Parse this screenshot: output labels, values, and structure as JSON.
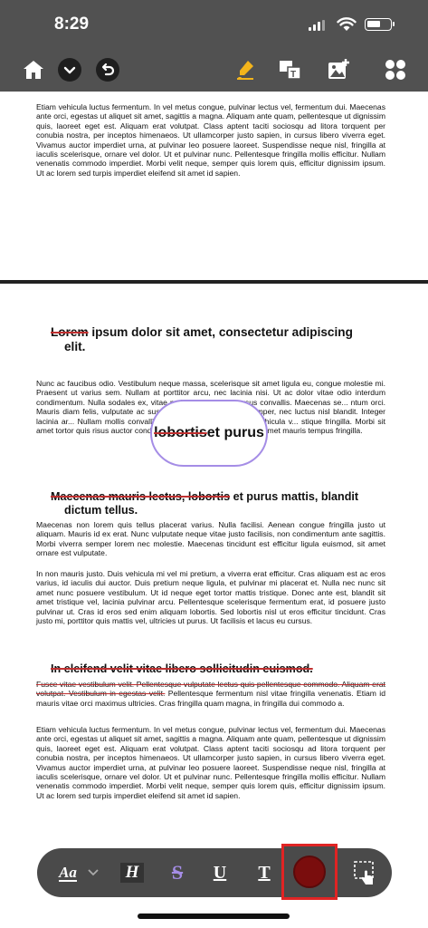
{
  "status_bar": {
    "time": "8:29"
  },
  "toolbar_top": {
    "icons": [
      "home-icon",
      "chevron-down-icon",
      "undo-icon",
      "highlighter-icon",
      "text-image-icon",
      "add-image-icon",
      "grid-menu-icon"
    ]
  },
  "document": {
    "page1_paragraph": "Etiam vehicula luctus fermentum. In vel metus congue, pulvinar lectus vel, fermentum dui. Maecenas ante orci, egestas ut aliquet sit amet, sagittis a magna. Aliquam ante quam, pellentesque ut dignissim quis, laoreet eget est. Aliquam erat volutpat. Class aptent taciti sociosqu ad litora torquent per conubia nostra, per inceptos himenaeos. Ut ullamcorper justo sapien, in cursus libero viverra eget. Vivamus auctor imperdiet urna, at pulvinar leo posuere laoreet. Suspendisse neque nisl, fringilla at iaculis scelerisque, ornare vel dolor. Ut et pulvinar nunc. Pellentesque fringilla mollis efficitur. Nullam venenatis commodo imperdiet. Morbi velit neque, semper quis lorem quis, efficitur dignissim ipsum. Ut ac lorem sed turpis imperdiet eleifend sit amet id sapien.",
    "heading1": {
      "struck": "Lorem",
      "rest_line1": " ipsum dolor sit amet, consectetur adipiscing",
      "rest_line2": "elit."
    },
    "para_a": "Nunc ac faucibus odio. Vestibulum neque massa, scelerisque sit amet ligula eu, congue molestie mi. Praesent ut varius sem. Nullam at porttitor arcu, nec lacinia nisi. Ut ac dolor vitae odio interdum condimentum. Nulla sodales ex, vitae malesuada ipsum cursus convallis. Maecenas se... ntum orci. Mauris diam felis, vulputate ac suscipit et, iaculi... ac ligula semper, nec luctus nisl blandit. Integer lacinia ar... Nullam mollis convallis ipsum, ac accumsan nunc vehicula v... stique fringilla. Morbi sit amet tortor quis risus auctor condime... ulla. Nulla iaculis tellus sit amet mauris tempus fringilla.",
    "magnifier": {
      "struck": "lobortis",
      "rest": " et purus"
    },
    "heading2": {
      "struck": "Maecenas mauris lectus, lobortis",
      "rest_line1": " et purus mattis, blandit",
      "rest_line2": "dictum tellus."
    },
    "para_b": "Maecenas non lorem quis tellus placerat varius. Nulla facilisi. Aenean congue fringilla justo ut aliquam. Mauris id ex erat. Nunc vulputate neque vitae justo facilisis, non condimentum ante sagittis. Morbi viverra semper lorem nec molestie. Maecenas tincidunt est efficitur ligula euismod, sit amet ornare est vulputate.",
    "para_c": "In non mauris justo. Duis vehicula mi vel mi pretium, a viverra erat efficitur. Cras aliquam est ac eros varius, id iaculis dui auctor. Duis pretium neque ligula, et pulvinar mi placerat et. Nulla nec nunc sit amet nunc posuere vestibulum. Ut id neque eget tortor mattis tristique. Donec ante est, blandit sit amet tristique vel, lacinia pulvinar arcu. Pellentesque scelerisque fermentum erat, id posuere justo pulvinar ut. Cras id eros sed enim aliquam lobortis. Sed lobortis nisl ut eros efficitur tincidunt. Cras justo mi, porttitor quis mattis vel, ultricies ut purus. Ut facilisis et lacus eu cursus.",
    "heading3": "In eleifend velit vitae libero sollicitudin euismod.",
    "para_d_struck": "Fusce vitae vestibulum velit. Pellentesque vulputate lectus quis pellentesque commodo. Aliquam erat volutpat. Vestibulum in egestas velit.",
    "para_d_rest": " Pellentesque fermentum nisl vitae fringilla venenatis. Etiam id mauris vitae orci maximus ultricies. Cras fringilla quam magna, in fringilla dui commodo a.",
    "para_e": "Etiam vehicula luctus fermentum. In vel metus congue, pulvinar lectus vel, fermentum dui. Maecenas ante orci, egestas ut aliquet sit amet, sagittis a magna. Aliquam ante quam, pellentesque ut dignissim quis, laoreet eget est. Aliquam erat volutpat. Class aptent taciti sociosqu ad litora torquent per conubia nostra, per inceptos himenaeos. Ut ullamcorper justo sapien, in cursus libero viverra eget. Vivamus auctor imperdiet urna, at pulvinar leo posuere laoreet. Suspendisse neque nisl, fringilla at iaculis scelerisque, ornare vel dolor. Ut et pulvinar nunc. Pellentesque fringilla mollis efficitur. Nullam venenatis commodo imperdiet. Morbi velit neque, semper quis lorem quis, efficitur dignissim ipsum. Ut ac lorem sed turpis imperdiet eleifend sit amet id sapien."
  },
  "bottom_toolbar": {
    "font_label": "Aa",
    "highlight_label": "H",
    "strike_label": "S",
    "underline_label": "U",
    "text_label": "T",
    "selected_color": "#7a0d0d",
    "accent_strike_color": "#a58de6",
    "selection_border_color": "#e02424"
  }
}
